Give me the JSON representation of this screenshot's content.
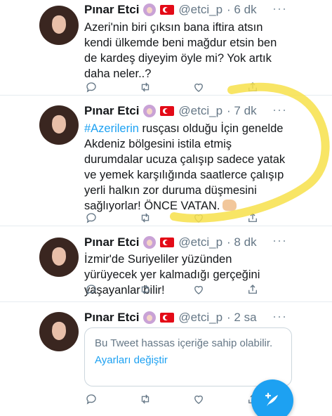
{
  "tweets": [
    {
      "name": "Pınar Etci",
      "handle": "@etci_p",
      "time": "· 6 dk",
      "text": "Azeri'nin biri çıksın bana iftira atsın kendi ülkemde beni mağdur etsin ben de kardeş diyeyim öyle mi? Yok artık daha neler..?"
    },
    {
      "name": "Pınar Etci",
      "handle": "@etci_p",
      "time": "· 7 dk",
      "hashtag": "#Azerilerin",
      "text": " rusçası olduğu İçin genelde Akdeniz bölgesini istila etmiş durumdalar ucuza çalışıp sadece yatak ve yemek karşılığında saatlerce çalışıp yerli halkın zor duruma düşmesini sağlıyorlar! ÖNCE VATAN."
    },
    {
      "name": "Pınar Etci",
      "handle": "@etci_p",
      "time": "· 8 dk",
      "text": "İzmir'de Suriyeliler yüzünden yürüyecek yer kalmadığı gerçeğini yaşayanlar bilir!"
    },
    {
      "name": "Pınar Etci",
      "handle": "@etci_p",
      "time": "· 2 sa",
      "sensitive_text": "Bu Tweet hassas içeriğe sahip olabilir.",
      "sensitive_link": "Ayarları değiştir"
    }
  ],
  "more_label": "···",
  "icons": {
    "reply": "reply-icon",
    "retweet": "retweet-icon",
    "like": "heart-icon",
    "share": "share-icon",
    "compose": "compose-tweet-icon"
  },
  "colors": {
    "accent": "#1da1f2",
    "highlight": "#f7e04a"
  }
}
